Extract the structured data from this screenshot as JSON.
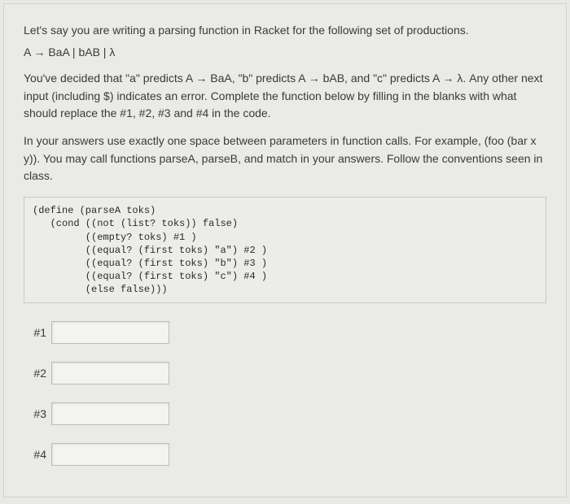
{
  "intro": "Let's say you are writing a parsing function in Racket for the following set of productions.",
  "grammar": "A → BaA | bAB | λ",
  "para1": "You've decided that \"a\" predicts A → BaA, \"b\" predicts A → bAB, and \"c\" predicts A → λ. Any other next input (including $) indicates an error. Complete the function below by filling in the blanks with what should replace the #1, #2, #3 and #4 in the code.",
  "para2": "In your answers use exactly one space between parameters in function calls. For example, (foo (bar x y)). You may call functions parseA, parseB, and match in your answers. Follow the conventions seen in class.",
  "code": "(define (parseA toks)\n   (cond ((not (list? toks)) false)\n         ((empty? toks) #1 )\n         ((equal? (first toks) \"a\") #2 )\n         ((equal? (first toks) \"b\") #3 )\n         ((equal? (first toks) \"c\") #4 )\n         (else false)))",
  "answers": [
    {
      "label": "#1",
      "value": ""
    },
    {
      "label": "#2",
      "value": ""
    },
    {
      "label": "#3",
      "value": ""
    },
    {
      "label": "#4",
      "value": ""
    }
  ]
}
